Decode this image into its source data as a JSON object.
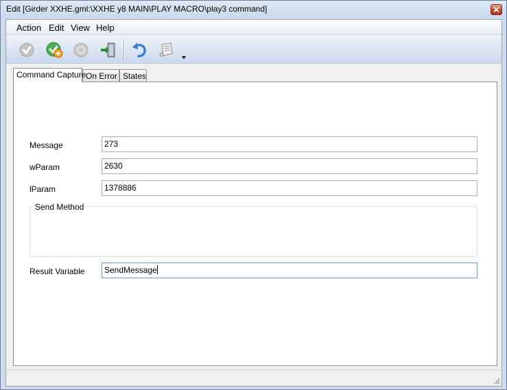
{
  "window": {
    "title": "Edit [Girder XXHE.gml:\\XXHE y8 MAIN\\PLAY MACRO\\play3 command]"
  },
  "menu": {
    "items": [
      {
        "label": "Action"
      },
      {
        "label": "Edit"
      },
      {
        "label": "View"
      },
      {
        "label": "Help"
      }
    ]
  },
  "toolbar": {
    "buttons": [
      {
        "icon": "checkmark-icon",
        "enabled": false
      },
      {
        "icon": "apply-test-icon",
        "enabled": true
      },
      {
        "icon": "cancel-icon",
        "enabled": false
      },
      {
        "icon": "exit-door-icon",
        "enabled": true
      },
      {
        "icon": "undo-icon",
        "enabled": true
      },
      {
        "icon": "script-scroll-icon",
        "enabled": true,
        "has_dropdown": true
      }
    ]
  },
  "tabs": [
    {
      "label": "Command Capture",
      "active": true
    },
    {
      "label": "On Error",
      "active": false
    },
    {
      "label": "States",
      "active": false
    }
  ],
  "form": {
    "message": {
      "label": "Message",
      "value": "273"
    },
    "wparam": {
      "label": "wParam",
      "value": "2630"
    },
    "lparam": {
      "label": "lParam",
      "value": "1378886"
    },
    "send_method": {
      "label": "Send Method"
    },
    "result_variable": {
      "label": "Result Variable",
      "value": "SendMessage"
    }
  },
  "colors": {
    "titlebar": "#c9d8ec",
    "close_button": "#c7452a",
    "toolbar": "#cad8ec",
    "focus_border": "#5b9bd5"
  }
}
